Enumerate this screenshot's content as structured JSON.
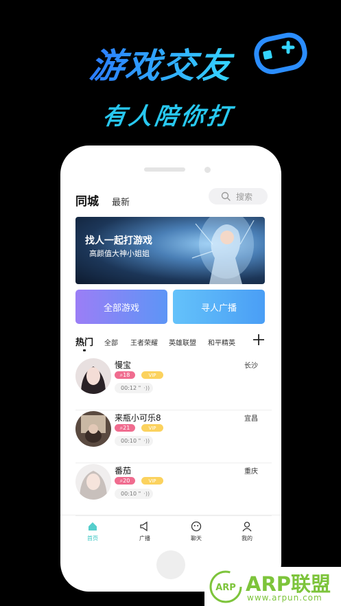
{
  "promo": {
    "title": "游戏交友",
    "subtitle": "有人陪你打"
  },
  "header": {
    "tab_city": "同城",
    "tab_latest": "最新",
    "search_placeholder": "搜索"
  },
  "banner": {
    "title": "找人一起打游戏",
    "subtitle": "高颜值大神小姐姐"
  },
  "actions": {
    "all_games": "全部游戏",
    "find_broadcast": "寻人广播"
  },
  "categories": {
    "hot": "热门",
    "items": [
      "全部",
      "王者荣耀",
      "英雄联盟",
      "和平精英"
    ]
  },
  "users": [
    {
      "name": "慢宝",
      "city": "长沙",
      "messages": "18",
      "vip": "VIP",
      "duration": "00:12 \""
    },
    {
      "name": "来瓶小可乐8",
      "city": "宜昌",
      "messages": "21",
      "vip": "VIP",
      "duration": "00:10 \""
    },
    {
      "name": "番茄",
      "city": "重庆",
      "messages": "20",
      "vip": "VIP",
      "duration": "00:10 \""
    }
  ],
  "tabbar": {
    "items": [
      "首页",
      "广播",
      "聊天",
      "我的"
    ],
    "active_color": "#37c6c3"
  },
  "watermark": {
    "logo_text": "ARP",
    "title": "ARP联盟",
    "url": "www.arpun.com"
  },
  "colors": {
    "promo_blue": "#2b7bff",
    "promo_cyan": "#28c8f0",
    "badge_pink": "#f06c8f",
    "badge_yellow": "#fbd25e",
    "watermark_green": "#7dc43b"
  }
}
